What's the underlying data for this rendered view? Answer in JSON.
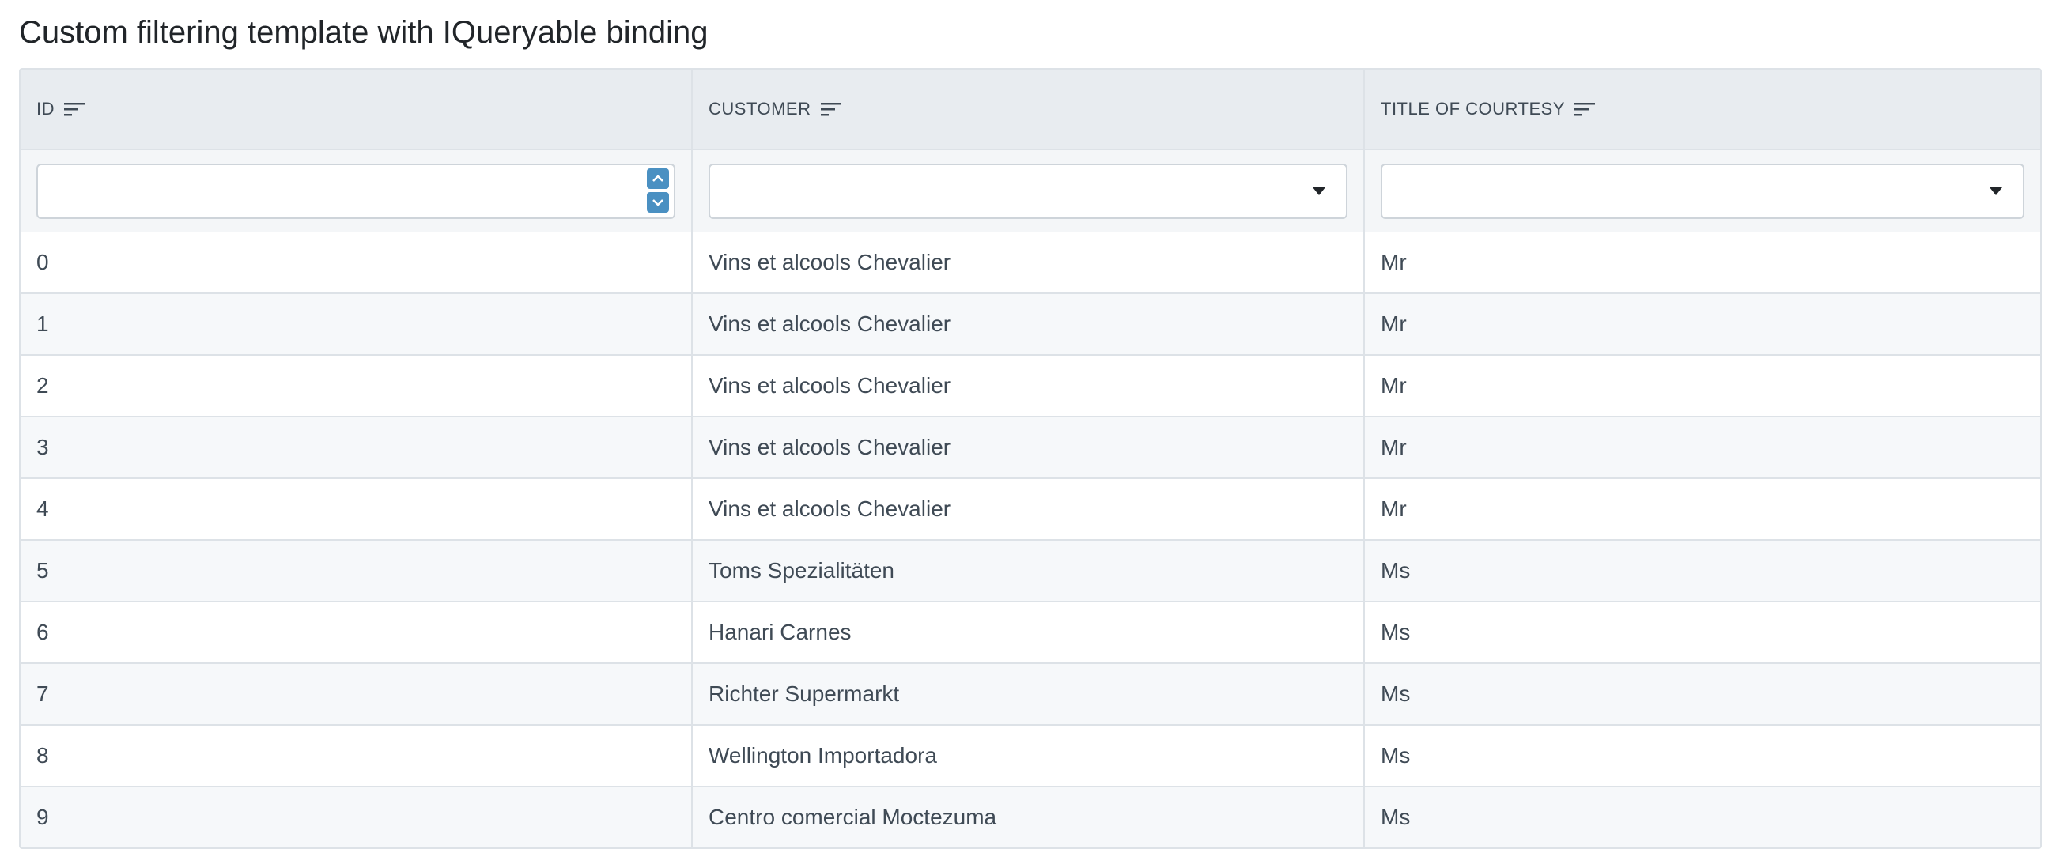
{
  "page": {
    "title": "Custom filtering template with IQueryable binding"
  },
  "columns": [
    {
      "label": "ID",
      "icon": "sort-icon"
    },
    {
      "label": "CUSTOMER",
      "icon": "sort-icon"
    },
    {
      "label": "TITLE OF COURTESY",
      "icon": "sort-icon"
    }
  ],
  "filters": {
    "id_value": "",
    "customer_value": "",
    "title_value": ""
  },
  "rows": [
    {
      "id": "0",
      "customer": "Vins et alcools Chevalier",
      "title": "Mr"
    },
    {
      "id": "1",
      "customer": "Vins et alcools Chevalier",
      "title": "Mr"
    },
    {
      "id": "2",
      "customer": "Vins et alcools Chevalier",
      "title": "Mr"
    },
    {
      "id": "3",
      "customer": "Vins et alcools Chevalier",
      "title": "Mr"
    },
    {
      "id": "4",
      "customer": "Vins et alcools Chevalier",
      "title": "Mr"
    },
    {
      "id": "5",
      "customer": "Toms Spezialitäten",
      "title": "Ms"
    },
    {
      "id": "6",
      "customer": "Hanari Carnes",
      "title": "Ms"
    },
    {
      "id": "7",
      "customer": "Richter Supermarkt",
      "title": "Ms"
    },
    {
      "id": "8",
      "customer": "Wellington Importadora",
      "title": "Ms"
    },
    {
      "id": "9",
      "customer": "Centro comercial Moctezuma",
      "title": "Ms"
    }
  ],
  "colors": {
    "header_bg": "#e8ecf0",
    "spin_button": "#4a90c2",
    "alt_row_bg": "#f6f8fa"
  }
}
